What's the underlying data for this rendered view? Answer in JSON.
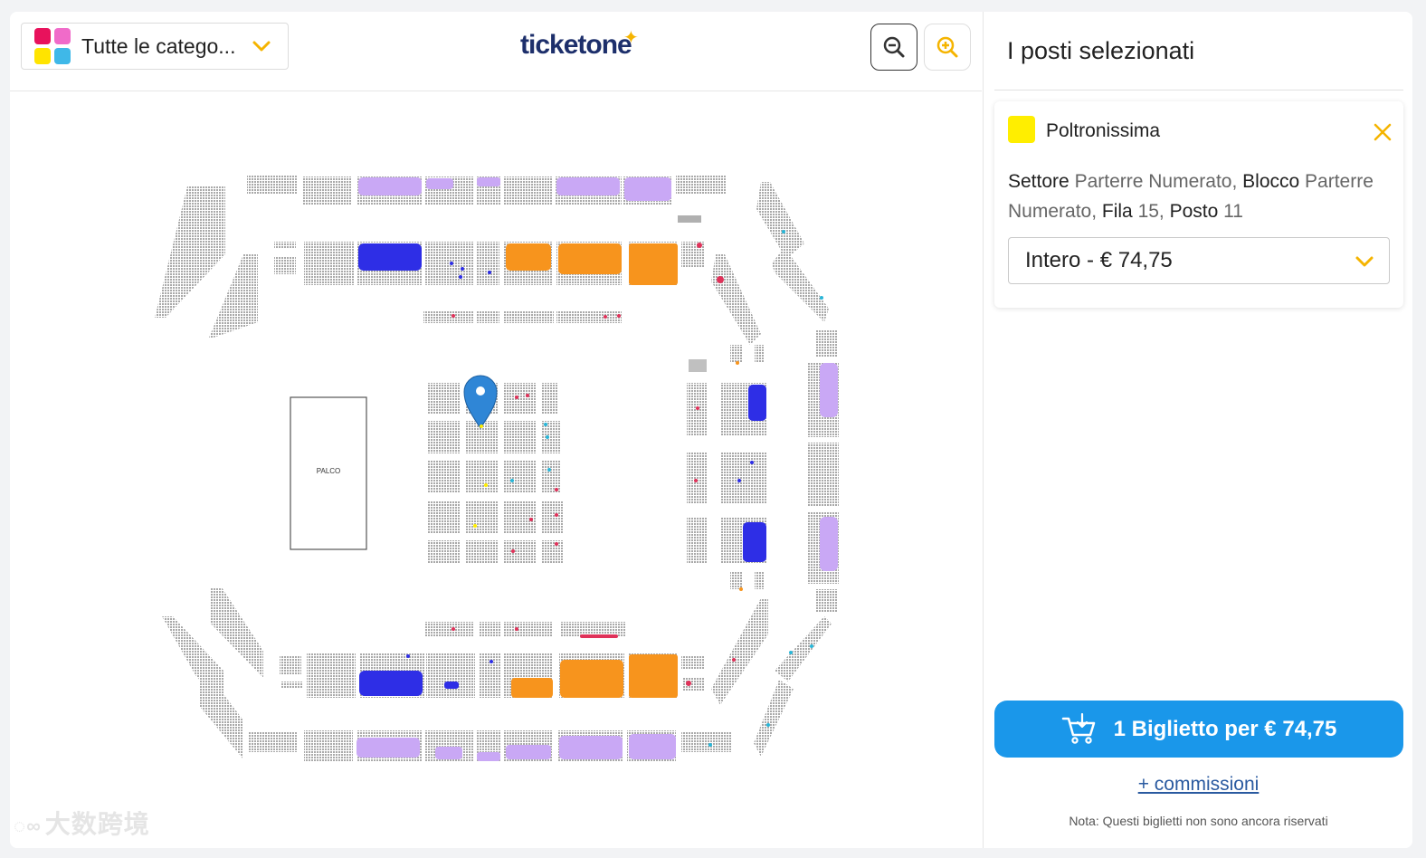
{
  "header": {
    "category_label": "Tutte le catego...",
    "logo_text": "ticketone"
  },
  "map": {
    "stage_label": "PALCO"
  },
  "watermark": "大数跨境",
  "side": {
    "title": "I posti selezionati",
    "seat": {
      "category": "Poltronissima",
      "category_color": "#ffee00",
      "settore_label": "Settore",
      "settore_value": "Parterre Numerato,",
      "blocco_label": "Blocco",
      "blocco_value": "Parterre Numerato,",
      "fila_label": "Fila",
      "fila_value": "15,",
      "posto_label": "Posto",
      "posto_value": "11"
    },
    "ticket_type": "Intero - € 74,75",
    "buy_label": "1 Biglietto per € 74,75",
    "fees_link": "+ commissioni",
    "note": "Nota: Questi biglietti non sono ancora riservati"
  },
  "colors": {
    "accent": "#f5b400",
    "buy_button": "#1a97ea",
    "lilac": "#c9a8f5",
    "blue": "#2e2ee6",
    "orange": "#f7941d",
    "red": "#e0325a",
    "cyan": "#29b6d8"
  }
}
